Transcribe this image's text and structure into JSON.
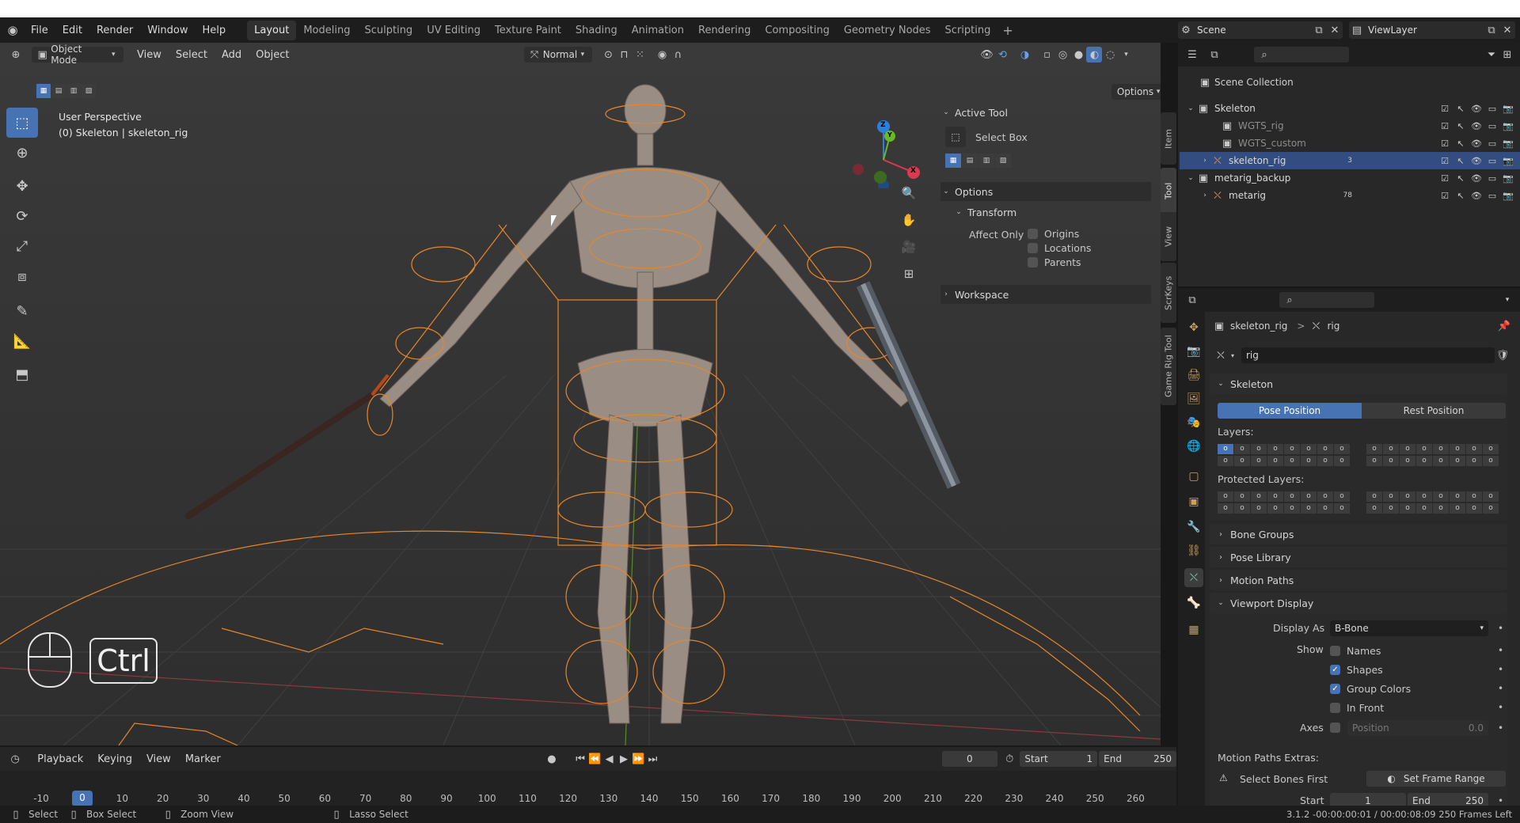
{
  "topbar": {
    "menus": [
      "File",
      "Edit",
      "Render",
      "Window",
      "Help"
    ],
    "workspaces": [
      "Layout",
      "Modeling",
      "Sculpting",
      "UV Editing",
      "Texture Paint",
      "Shading",
      "Animation",
      "Rendering",
      "Compositing",
      "Geometry Nodes",
      "Scripting"
    ],
    "active_workspace": "Layout",
    "add_tab": "+",
    "scene": "Scene",
    "view_layer": "ViewLayer"
  },
  "viewport": {
    "mode": "Object Mode",
    "menus": [
      "View",
      "Select",
      "Add",
      "Object"
    ],
    "orientation": "Normal",
    "options_label": "Options",
    "perspective_label": "User Perspective",
    "object_label": "(0) Skeleton | skeleton_rig",
    "gizmo_axes": {
      "x": "X",
      "y": "Y",
      "z": "Z"
    },
    "key_overlay": "Ctrl"
  },
  "npanel": {
    "active_tool_title": "Active Tool",
    "tool_name": "Select Box",
    "options_title": "Options",
    "transform_title": "Transform",
    "affect_only_label": "Affect Only",
    "affect_items": [
      {
        "label": "Origins",
        "checked": false
      },
      {
        "label": "Locations",
        "checked": false
      },
      {
        "label": "Parents",
        "checked": false
      }
    ],
    "workspace_title": "Workspace",
    "tabs": [
      "Item",
      "Tool",
      "View",
      "ScrKeys",
      "Game Rig Tool"
    ],
    "active_tab": "Tool"
  },
  "outliner": {
    "scene_collection": "Scene Collection",
    "items": [
      {
        "name": "Skeleton",
        "depth": 1,
        "kind": "collection"
      },
      {
        "name": "WGTS_rig",
        "depth": 2,
        "kind": "collection"
      },
      {
        "name": "WGTS_custom",
        "depth": 2,
        "kind": "collection"
      },
      {
        "name": "skeleton_rig",
        "depth": 2,
        "kind": "armature",
        "selected": true,
        "badge": "3"
      },
      {
        "name": "metarig_backup",
        "depth": 1,
        "kind": "collection"
      },
      {
        "name": "metarig",
        "depth": 2,
        "kind": "armature",
        "badge": "78"
      }
    ]
  },
  "properties": {
    "breadcrumb_object": "skeleton_rig",
    "breadcrumb_sep": ">",
    "breadcrumb_data": "rig",
    "data_name": "rig",
    "skeleton_title": "Skeleton",
    "pose_position": "Pose Position",
    "rest_position": "Rest Position",
    "layers_label": "Layers:",
    "protected_layers_label": "Protected Layers:",
    "bone_groups": "Bone Groups",
    "pose_library": "Pose Library",
    "motion_paths": "Motion Paths",
    "viewport_display": "Viewport Display",
    "display_as_label": "Display As",
    "display_as_value": "B-Bone",
    "show_label": "Show",
    "show_items": [
      {
        "label": "Names",
        "checked": false
      },
      {
        "label": "Shapes",
        "checked": true
      },
      {
        "label": "Group Colors",
        "checked": true
      },
      {
        "label": "In Front",
        "checked": false
      }
    ],
    "axes_label": "Axes",
    "axes_position_label": "Position",
    "axes_position_value": "0.0",
    "motion_paths_extras": "Motion Paths Extras:",
    "select_bones_first": "Select Bones First",
    "set_frame_range": "Set Frame Range",
    "start_label": "Start",
    "start_value": "1",
    "end_label": "End",
    "end_value": "250"
  },
  "timeline": {
    "menus": [
      "Playback",
      "Keying",
      "View",
      "Marker"
    ],
    "current_frame": "0",
    "start_label": "Start",
    "start_value": "1",
    "end_label": "End",
    "end_value": "250",
    "ticks": [
      "-10",
      "0",
      "10",
      "20",
      "30",
      "40",
      "50",
      "60",
      "70",
      "80",
      "90",
      "100",
      "110",
      "120",
      "130",
      "140",
      "150",
      "160",
      "170",
      "180",
      "190",
      "200",
      "210",
      "220",
      "230",
      "240",
      "250",
      "260"
    ]
  },
  "statusbar": {
    "select": "Select",
    "box_select": "Box Select",
    "zoom_view": "Zoom View",
    "lasso_select": "Lasso Select",
    "info": "3.1.2  -00:00:00:01 / 00:00:08:09  250 Frames Left"
  }
}
